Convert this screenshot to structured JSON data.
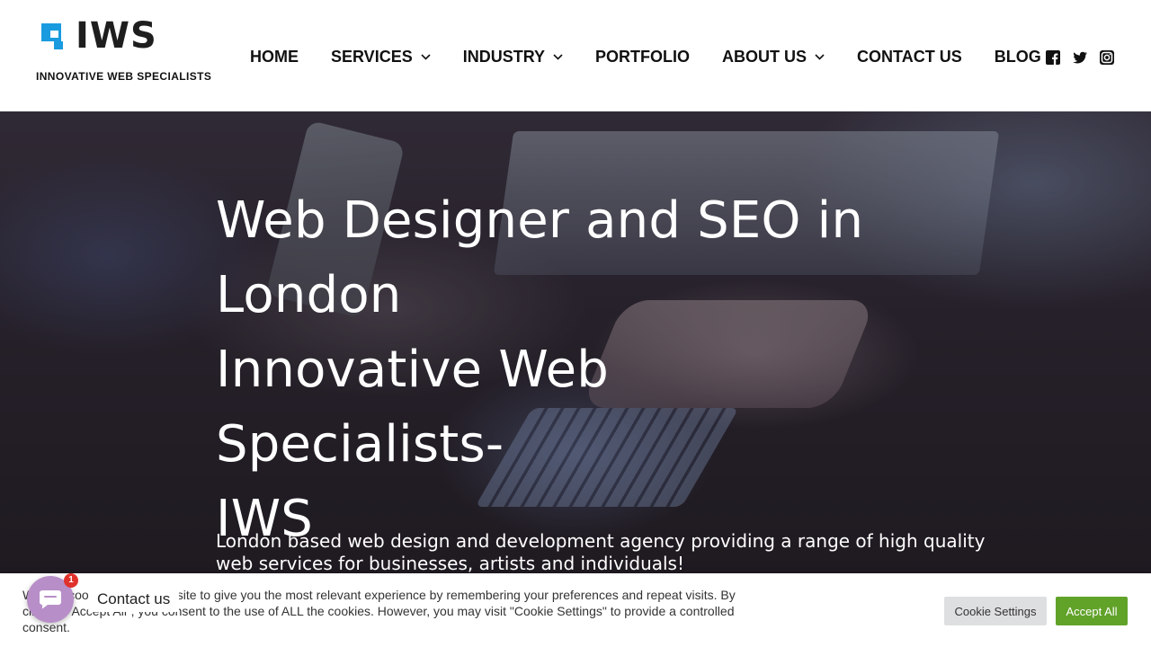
{
  "brand": {
    "wordmark": "IWS",
    "tagline": "INNOVATIVE WEB SPECIALISTS",
    "colors": {
      "logo_square": "#1a9be0",
      "logo_text": "#1e1e1e"
    }
  },
  "nav": {
    "items": [
      {
        "label": "HOME",
        "has_dropdown": false
      },
      {
        "label": "SERVICES",
        "has_dropdown": true
      },
      {
        "label": "INDUSTRY",
        "has_dropdown": true
      },
      {
        "label": "PORTFOLIO",
        "has_dropdown": false
      },
      {
        "label": "ABOUT US",
        "has_dropdown": true
      },
      {
        "label": "CONTACT US",
        "has_dropdown": false
      },
      {
        "label": "BLOG",
        "has_dropdown": false
      }
    ],
    "social_icons": [
      "facebook-icon",
      "twitter-icon",
      "instagram-icon"
    ]
  },
  "hero": {
    "title_lines": [
      "Web Designer and SEO in",
      "London",
      "Innovative Web Specialists-",
      "IWS"
    ],
    "subtitle": "London based web design and development agency providing a range of high quality web services for businesses, artists and individuals!"
  },
  "cookie": {
    "text": "We use cookies on our website to give you the most relevant experience by remembering your preferences and repeat visits. By clicking “Accept All”, you consent to the use of ALL the cookies. However, you may visit \"Cookie Settings\" to provide a controlled consent.",
    "settings_label": "Cookie Settings",
    "accept_label": "Accept All",
    "colors": {
      "accept": "#61a229",
      "settings": "#dedfe0"
    }
  },
  "contact_widget": {
    "label": "Contact us",
    "badge_count": "1",
    "icon": "chat-icon",
    "color": "#b88ec8"
  }
}
